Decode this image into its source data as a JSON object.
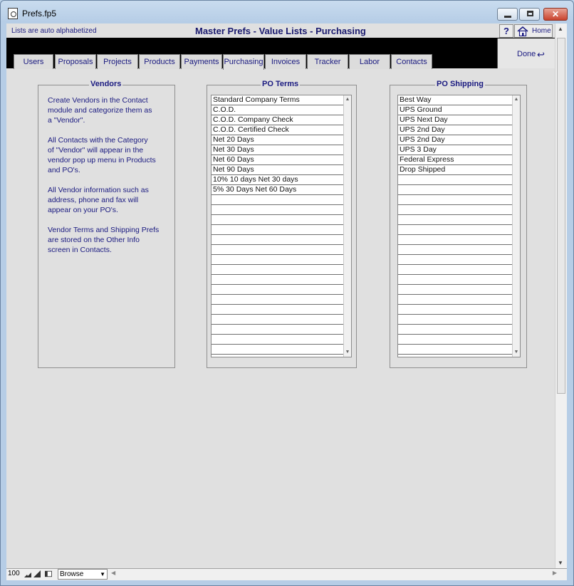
{
  "window": {
    "title": "Prefs.fp5",
    "close_glyph": "✕"
  },
  "header": {
    "hint": "Lists are auto alphabetized",
    "layout_title": "Master Prefs - Value Lists - Purchasing",
    "help_label": "?",
    "home_label": "Home",
    "done_label": "Done"
  },
  "tabs": [
    {
      "label": "Users"
    },
    {
      "label": "Proposals"
    },
    {
      "label": "Projects"
    },
    {
      "label": "Products"
    },
    {
      "label": "Payments"
    },
    {
      "label": "Purchasing",
      "active": true
    },
    {
      "label": "Invoices"
    },
    {
      "label": "Tracker"
    },
    {
      "label": "Labor"
    },
    {
      "label": "Contacts"
    }
  ],
  "vendors": {
    "title": "Vendors",
    "paragraphs": [
      "Create Vendors in the Contact\nmodule and categorize them as\na \"Vendor\".",
      "All Contacts with the Category\nof \"Vendor\" will appear in the\nvendor pop up menu in Products\nand PO's.",
      "All Vendor information such as\naddress, phone and fax will\nappear on your PO's.",
      "Vendor Terms and Shipping Prefs\nare stored on the Other Info\nscreen in Contacts."
    ]
  },
  "po_terms": {
    "title": "PO Terms",
    "items": [
      "Standard Company Terms",
      "C.O.D.",
      "C.O.D. Company Check",
      "C.O.D. Certified Check",
      "Net 20 Days",
      "Net 30 Days",
      "Net 60 Days",
      "Net 90 Days",
      "10% 10 days Net 30 days",
      "5% 30 Days Net 60 Days"
    ]
  },
  "po_shipping": {
    "title": "PO Shipping",
    "items": [
      "Best Way",
      "UPS Ground",
      "UPS Next Day",
      "UPS 2nd Day",
      "UPS 2nd Day",
      "UPS 3 Day",
      "Federal Express",
      "Drop Shipped"
    ]
  },
  "statusbar": {
    "zoom": "100",
    "mode": "Browse"
  }
}
